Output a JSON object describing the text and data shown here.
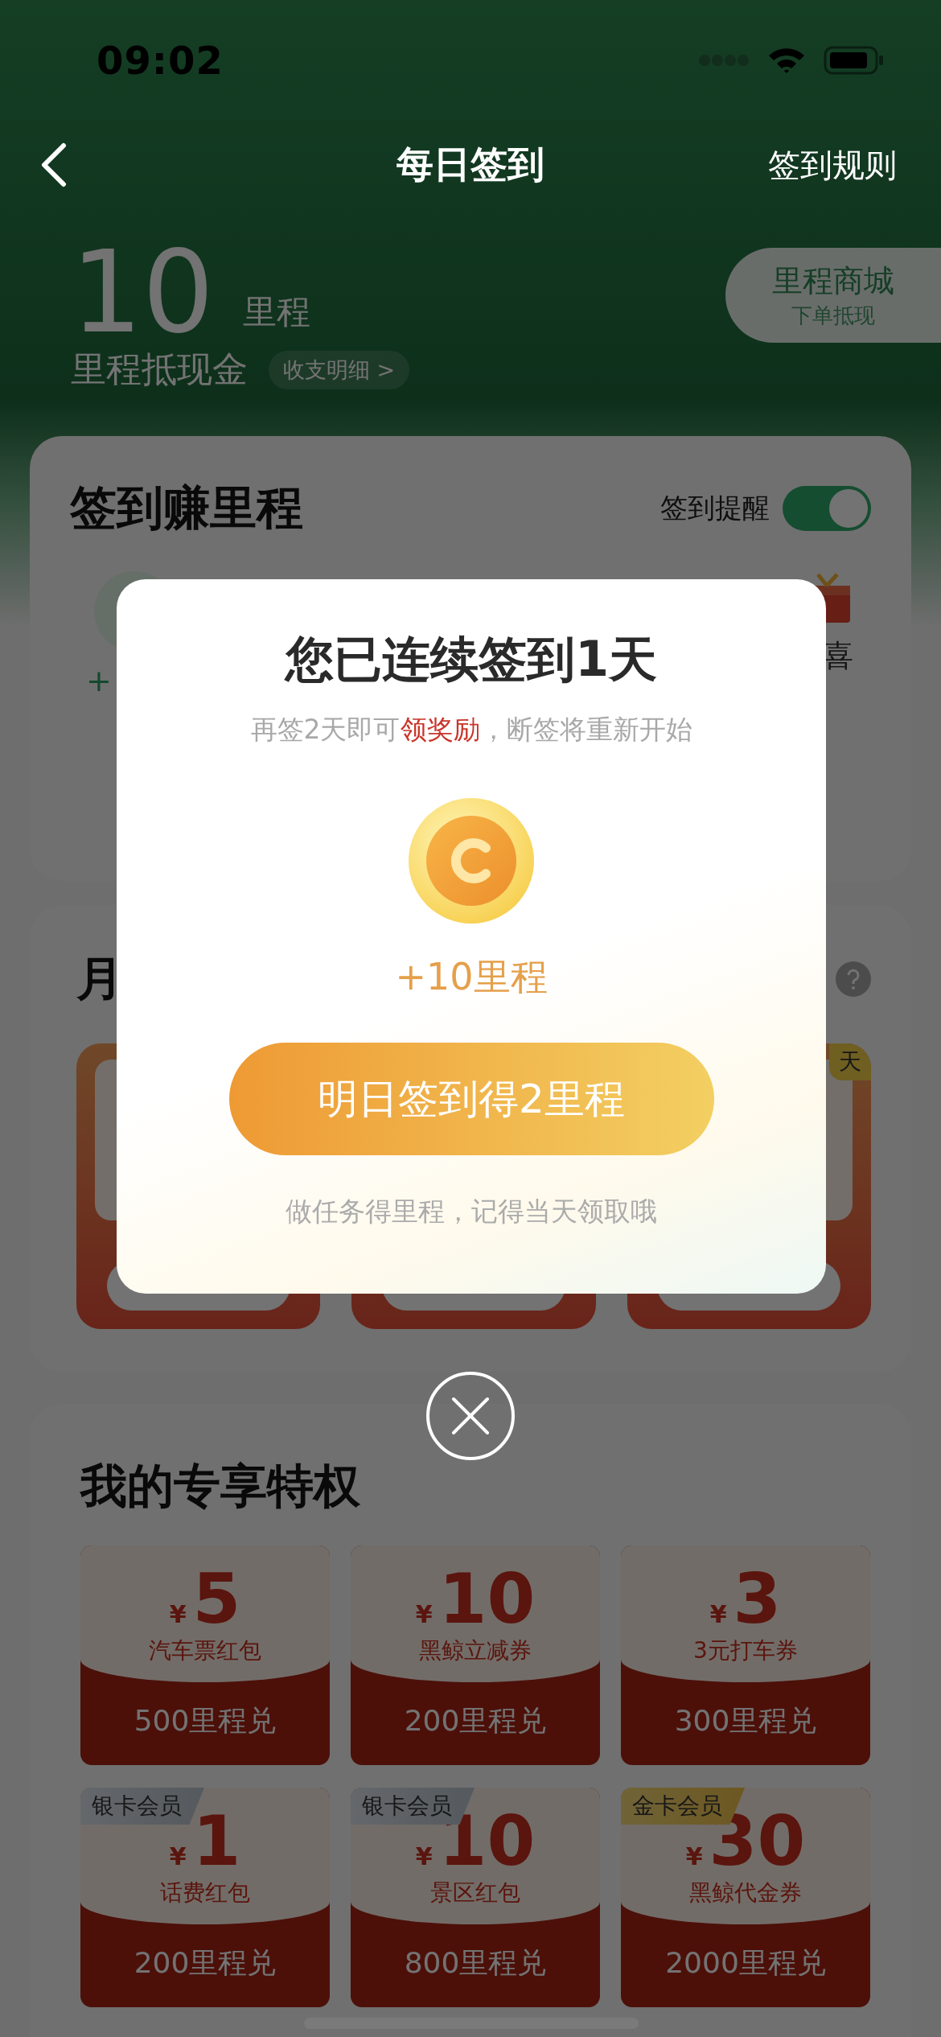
{
  "status_bar": {
    "time": "09:02"
  },
  "nav": {
    "title": "每日签到",
    "rules_link": "签到规则"
  },
  "balance": {
    "amount": "10",
    "unit": "里程",
    "label": "里程抵现金",
    "details_link": "收支明细 >"
  },
  "mall_button": {
    "title": "里程商城",
    "subtitle": "下单抵现"
  },
  "checkin_card": {
    "title": "签到赚里程",
    "reminder": {
      "label": "签到提醒",
      "on": true
    },
    "left_fragment": "+",
    "right_fragment": "喜"
  },
  "monthly_card": {
    "title_fragment": "月",
    "ribbon_fragment": "天"
  },
  "privileges": {
    "title": "我的专享特权",
    "items": [
      {
        "currency": "¥",
        "value": "5",
        "name": "汽车票红包",
        "price": "500里程兑"
      },
      {
        "currency": "¥",
        "value": "10",
        "name": "黑鲸立减券",
        "price": "200里程兑"
      },
      {
        "currency": "¥",
        "value": "3",
        "name": "3元打车券",
        "price": "300里程兑"
      },
      {
        "tag": {
          "text": "银卡会员",
          "kind": "silver"
        },
        "currency": "¥",
        "value": "1",
        "name": "话费红包",
        "price": "200里程兑"
      },
      {
        "tag": {
          "text": "银卡会员",
          "kind": "silver"
        },
        "currency": "¥",
        "value": "10",
        "name": "景区红包",
        "price": "800里程兑"
      },
      {
        "tag": {
          "text": "金卡会员",
          "kind": "gold"
        },
        "currency": "¥",
        "value": "30",
        "name": "黑鲸代金券",
        "price": "2000里程兑"
      }
    ]
  },
  "modal": {
    "title": "您已连续签到1天",
    "subtitle_parts": [
      {
        "text": "再签2天即可",
        "highlight": false
      },
      {
        "text": "领奖励",
        "highlight": true
      },
      {
        "text": "，断签将重新开始",
        "highlight": false
      }
    ],
    "reward": "+10里程",
    "button": "明日签到得2里程",
    "footnote": "做任务得里程，记得当天领取哦"
  }
}
